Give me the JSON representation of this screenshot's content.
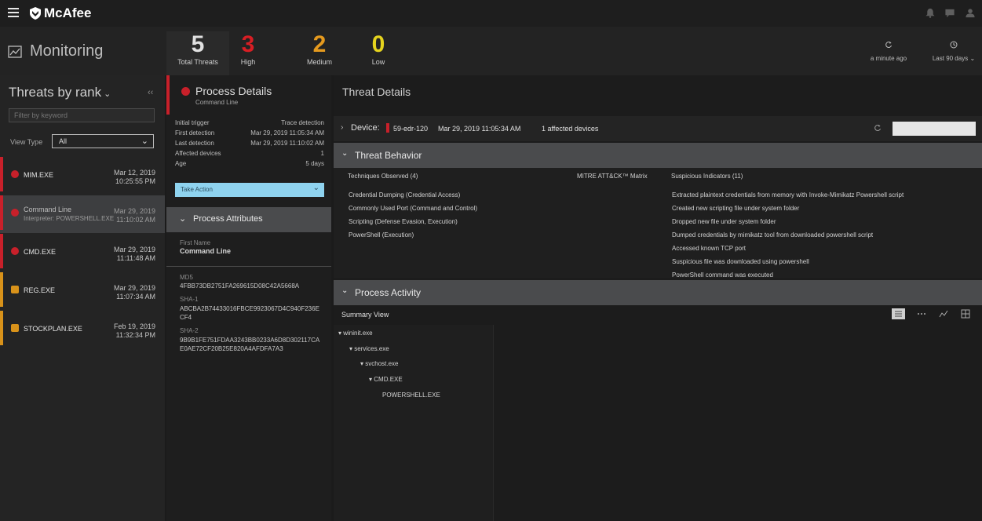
{
  "brand": {
    "name": "McAfee"
  },
  "header": {
    "title": "Monitoring",
    "stats": [
      {
        "value": "5",
        "label": "Total Threats",
        "color": "#e0e0e0"
      },
      {
        "value": "3",
        "label": "High",
        "color": "#d81e24"
      },
      {
        "value": "2",
        "label": "Medium",
        "color": "#e59a1e"
      },
      {
        "value": "0",
        "label": "Low",
        "color": "#e5d31e"
      }
    ],
    "refresh_label": "a minute ago",
    "range_label": "Last 90 days"
  },
  "left": {
    "title": "Threats by rank",
    "filter_placeholder": "Filter by keyword",
    "view_type_label": "View Type",
    "view_type_value": "All",
    "threats": [
      {
        "name": "MIM.EXE",
        "sub": "",
        "date": "Mar 12, 2019",
        "time": "10:25:55 PM",
        "severity": "high"
      },
      {
        "name": "Command Line",
        "sub": "Interpreter: POWERSHELL.EXE",
        "date": "Mar 29, 2019",
        "time": "11:10:02 AM",
        "severity": "high"
      },
      {
        "name": "CMD.EXE",
        "sub": "",
        "date": "Mar 29, 2019",
        "time": "11:11:48 AM",
        "severity": "high"
      },
      {
        "name": "REG.EXE",
        "sub": "",
        "date": "Mar 29, 2019",
        "time": "11:07:34 AM",
        "severity": "medium"
      },
      {
        "name": "STOCKPLAN.EXE",
        "sub": "",
        "date": "Feb 19, 2019",
        "time": "11:32:34 PM",
        "severity": "medium"
      }
    ]
  },
  "process": {
    "title": "Process Details",
    "subtitle": "Command Line",
    "fields": [
      {
        "label": "Initial trigger",
        "value": "Trace detection"
      },
      {
        "label": "First detection",
        "value": "Mar 29, 2019 11:05:34 AM"
      },
      {
        "label": "Last detection",
        "value": "Mar 29, 2019 11:10:02 AM"
      },
      {
        "label": "Affected devices",
        "value": "1"
      },
      {
        "label": "Age",
        "value": "5 days"
      }
    ],
    "action_label": "Take Action",
    "attributes_title": "Process Attributes",
    "first_name_label": "First Name",
    "first_name_value": "Command Line",
    "md5_label": "MD5",
    "md5_value": "4FBB73DB2751FA269615D08C42A5668A",
    "sha1_label": "SHA-1",
    "sha1_value": "ABCBA2B74433016FBCE9923067D4C940F236ECF4",
    "sha2_label": "SHA-2",
    "sha2_value": "9B9B1FE751FDAA3243BB0233A6D8D302117CAE0AE72CF20B25E820A4AFDFA7A3"
  },
  "details": {
    "title": "Threat Details",
    "device_label": "Device:",
    "device_name": "59-edr-120",
    "device_time": "Mar 29, 2019 11:05:34 AM",
    "affected": "1 affected devices",
    "behavior_title": "Threat Behavior",
    "techniques_header": "Techniques Observed (4)",
    "mitre_header": "MITRE ATT&CK™ Matrix",
    "indicators_header": "Suspicious Indicators (11)",
    "techniques": [
      "Credential Dumping (Credential Access)",
      "Commonly Used Port (Command and Control)",
      "Scripting (Defense Evasion, Execution)",
      "PowerShell (Execution)"
    ],
    "indicators": [
      "Extracted plaintext credentials from memory with Invoke-Mimikatz Powershell script",
      "Created new scripting file under system folder",
      "Dropped new file under system folder",
      "Dumped credentials by mimikatz tool from downloaded powershell script",
      "Accessed known TCP port",
      "Suspicious file was downloaded using powershell",
      "PowerShell command was executed"
    ],
    "activity_title": "Process Activity",
    "summary_label": "Summary View",
    "tree": [
      {
        "name": "wininit.exe",
        "depth": 0
      },
      {
        "name": "services.exe",
        "depth": 1
      },
      {
        "name": "svchost.exe",
        "depth": 2
      },
      {
        "name": "CMD.EXE",
        "depth": 3
      },
      {
        "name": "POWERSHELL.EXE",
        "depth": 4
      }
    ]
  },
  "colors": {
    "high": "#c8202a",
    "medium": "#d8921a",
    "accent": "#8fd3ef"
  }
}
